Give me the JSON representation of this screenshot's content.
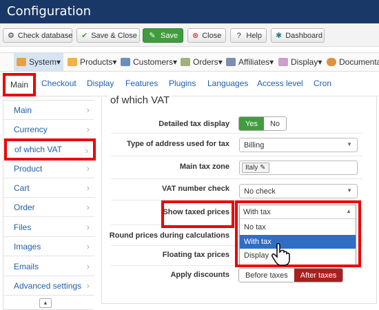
{
  "window": {
    "title": "Configuration"
  },
  "toolbar": {
    "check_database": "Check database",
    "save_close": "Save & Close",
    "save": "Save",
    "close": "Close",
    "help": "Help",
    "dashboard": "Dashboard"
  },
  "menu": {
    "items": [
      "System",
      "Products",
      "Customers",
      "Orders",
      "Affiliates",
      "Display",
      "Documenta"
    ]
  },
  "tabs": [
    "Main",
    "Checkout",
    "Display",
    "Features",
    "Plugins",
    "Languages",
    "Access level",
    "Cron"
  ],
  "sidebar": {
    "items": [
      "Main",
      "Currency",
      "of which VAT",
      "Product",
      "Cart",
      "Order",
      "Files",
      "Images",
      "Emails",
      "Advanced settings"
    ]
  },
  "panel": {
    "title": "of which VAT",
    "detailed_tax_display": {
      "label": "Detailed tax display",
      "yes": "Yes",
      "no": "No",
      "selected": "Yes"
    },
    "address_type": {
      "label": "Type of address used for tax",
      "value": "Billing"
    },
    "main_tax_zone": {
      "label": "Main tax zone",
      "value": "Italy"
    },
    "vat_number_check": {
      "label": "VAT number check",
      "value": "No check"
    },
    "show_taxed_prices": {
      "label": "Show taxed prices",
      "value": "With tax",
      "options": [
        "No tax",
        "With tax",
        "Display"
      ],
      "highlighted": "With tax"
    },
    "round_prices": {
      "label": "Round prices during calculations"
    },
    "floating_tax": {
      "label": "Floating tax prices"
    },
    "apply_discounts": {
      "label": "Apply discounts",
      "before": "Before taxes",
      "after": "After taxes",
      "selected": "After taxes"
    }
  },
  "colors": {
    "titlebar": "#1a3867",
    "highlight": "#e00000",
    "link": "#1f5ea8",
    "green": "#3f9d3f",
    "red": "#a91f1f",
    "dropdown_selected": "#2f6ec5"
  }
}
